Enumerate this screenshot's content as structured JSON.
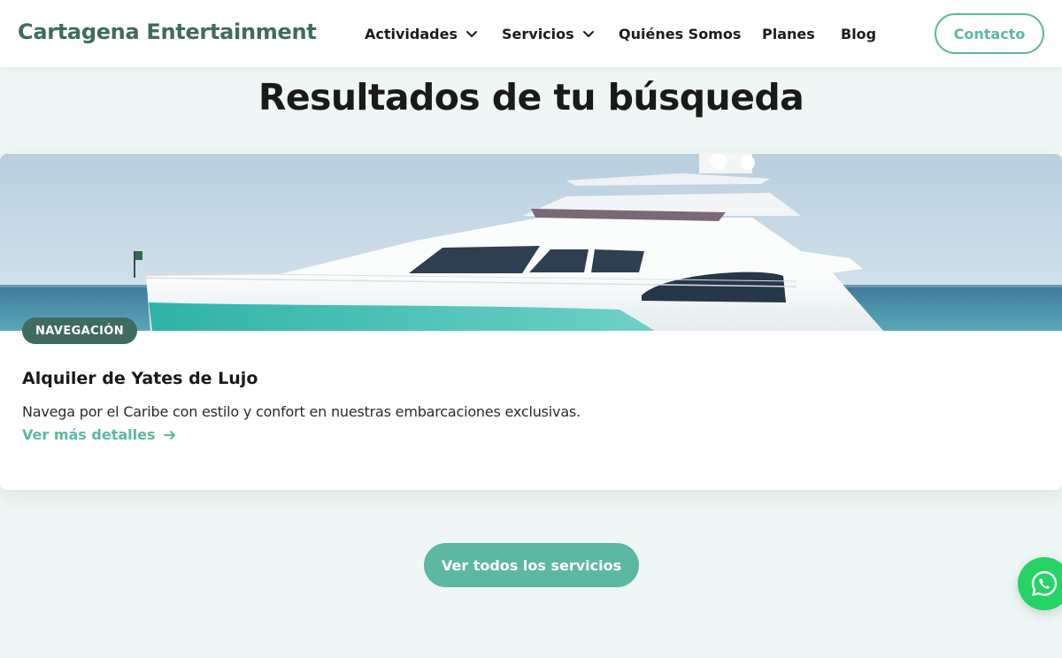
{
  "header": {
    "brand": "Cartagena Entertainment",
    "nav": [
      {
        "label": "Actividades",
        "dropdown": true
      },
      {
        "label": "Servicios",
        "dropdown": true
      },
      {
        "label": "Quiénes Somos",
        "dropdown": false
      },
      {
        "label": "Planes",
        "dropdown": false
      },
      {
        "label": "Blog",
        "dropdown": false
      }
    ],
    "contact_label": "Contacto"
  },
  "main": {
    "title": "Resultados de tu búsqueda",
    "results": [
      {
        "category": "NAVEGACIÓN",
        "title": "Alquiler de Yates de Lujo",
        "description": "Navega por el Caribe con estilo y confort en nuestras embarcaciones exclusivas.",
        "link_label": "Ver más detalles",
        "image": "luxury-yacht-photo"
      }
    ],
    "all_services_label": "Ver todos los servicios"
  },
  "floating": {
    "icon": "whatsapp-icon"
  },
  "colors": {
    "brand": "#3f6b60",
    "accent": "#5cb7a3",
    "page_bg": "#eef7f5",
    "whatsapp": "#25d366"
  }
}
